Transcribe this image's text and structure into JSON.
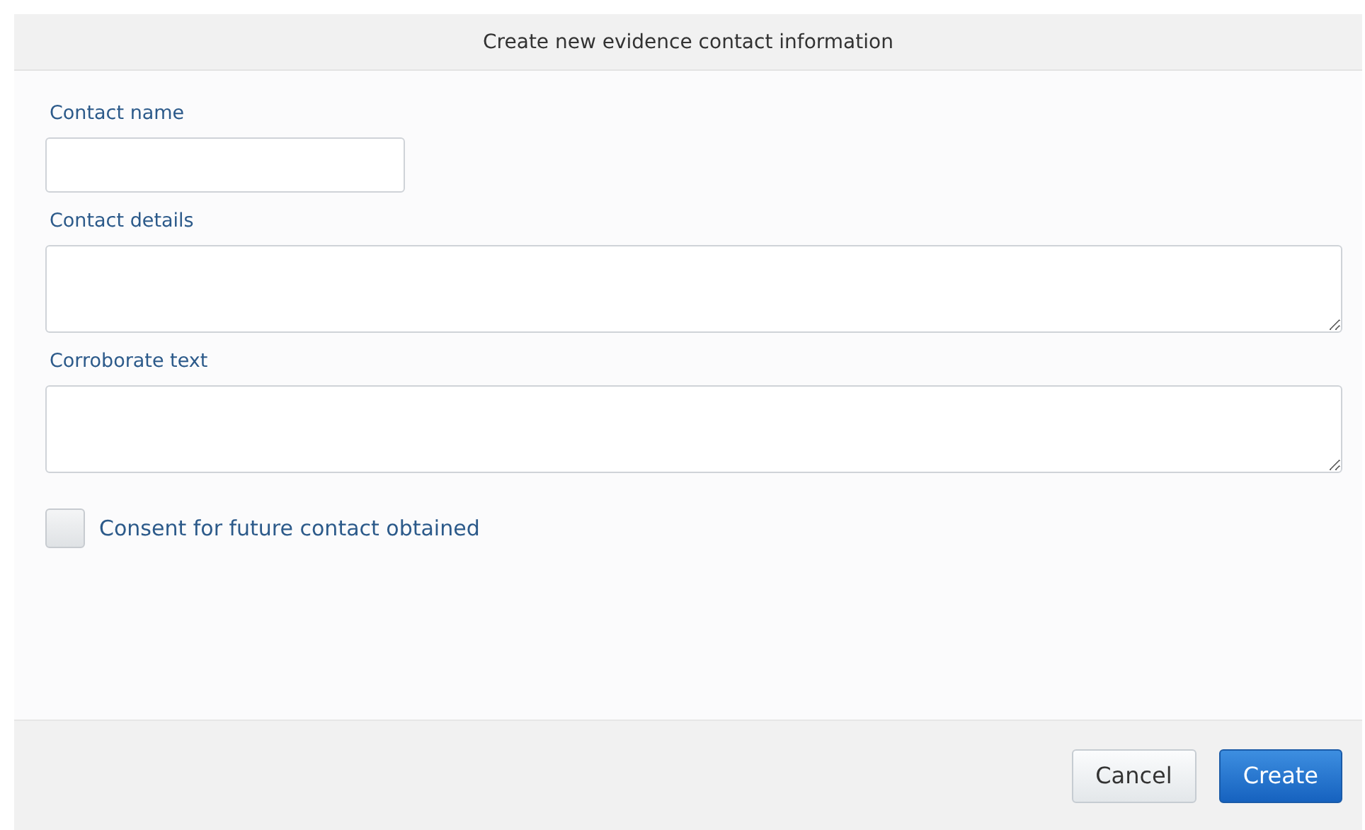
{
  "dialog": {
    "title": "Create new evidence contact information"
  },
  "fields": [
    {
      "label": "Contact name",
      "kind": "input"
    },
    {
      "label": "Contact details",
      "kind": "textarea"
    },
    {
      "label": "Corroborate text",
      "kind": "textarea"
    }
  ],
  "consent": {
    "label": "Consent for future contact obtained",
    "checked": false
  },
  "buttons": [
    {
      "label": "Cancel",
      "kind": "secondary"
    },
    {
      "label": "Create",
      "kind": "primary"
    }
  ]
}
